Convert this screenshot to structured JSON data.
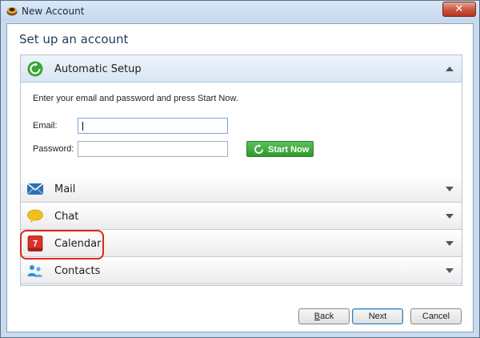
{
  "window": {
    "title": "New Account",
    "app_icon": "thunderbird-icon",
    "close_icon": "close-icon",
    "close_glyph": "✕"
  },
  "heading": "Set up an account",
  "sections": [
    {
      "id": "automatic",
      "label": "Automatic Setup",
      "icon": "refresh-icon",
      "expanded": true
    },
    {
      "id": "mail",
      "label": "Mail",
      "icon": "envelope-icon",
      "expanded": false
    },
    {
      "id": "chat",
      "label": "Chat",
      "icon": "speech-bubble-icon",
      "expanded": false
    },
    {
      "id": "calendar",
      "label": "Calendar",
      "icon": "calendar-icon",
      "calendar_day": "7",
      "expanded": false
    },
    {
      "id": "contacts",
      "label": "Contacts",
      "icon": "people-icon",
      "expanded": false
    }
  ],
  "automatic": {
    "instructions": "Enter your email and password and press Start Now.",
    "email_label": "Email:",
    "email_value": "",
    "password_label": "Password:",
    "password_value": "",
    "start_label": "Start Now"
  },
  "footer": {
    "back_label": "Back",
    "back_accel": "B",
    "back_rest": "ack",
    "next_label": "Next",
    "cancel_label": "Cancel"
  },
  "colors": {
    "accent_green": "#3aa638",
    "highlight_red": "#e0251b",
    "header_blue": "#d9e6f3"
  }
}
